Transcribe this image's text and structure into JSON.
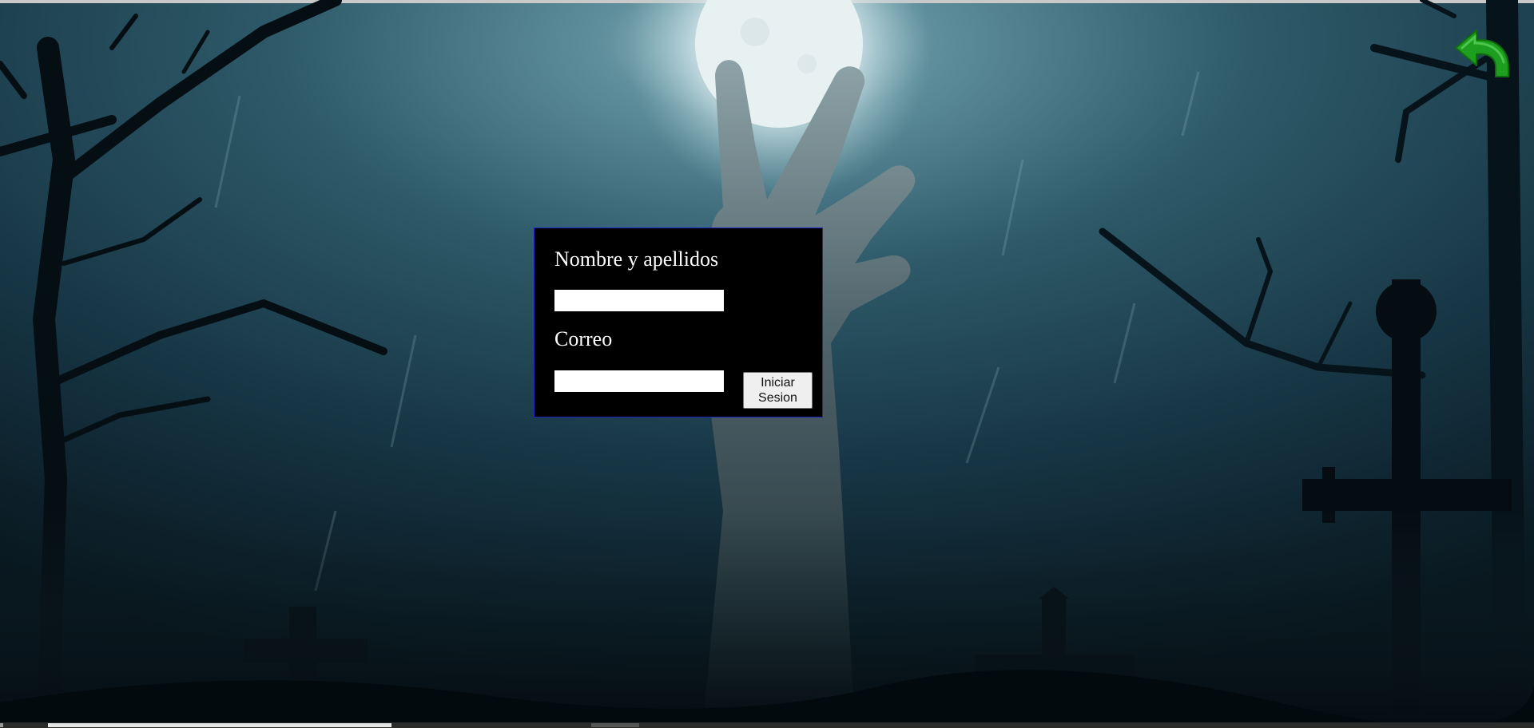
{
  "background": {
    "icon": "graveyard-zombie-hand-background",
    "colors": {
      "sky": "#2c5666",
      "moon": "#e8f1f2",
      "dark": "#0a1a22"
    }
  },
  "toolbar": {
    "back_icon": "green-curved-back-arrow-icon",
    "accent": "#1e9e1e"
  },
  "login": {
    "name_label": "Nombre y apellidos",
    "name_value": "",
    "email_label": "Correo",
    "email_value": "",
    "submit_label": "Iniciar Sesion",
    "border_color": "#1a23c8"
  }
}
